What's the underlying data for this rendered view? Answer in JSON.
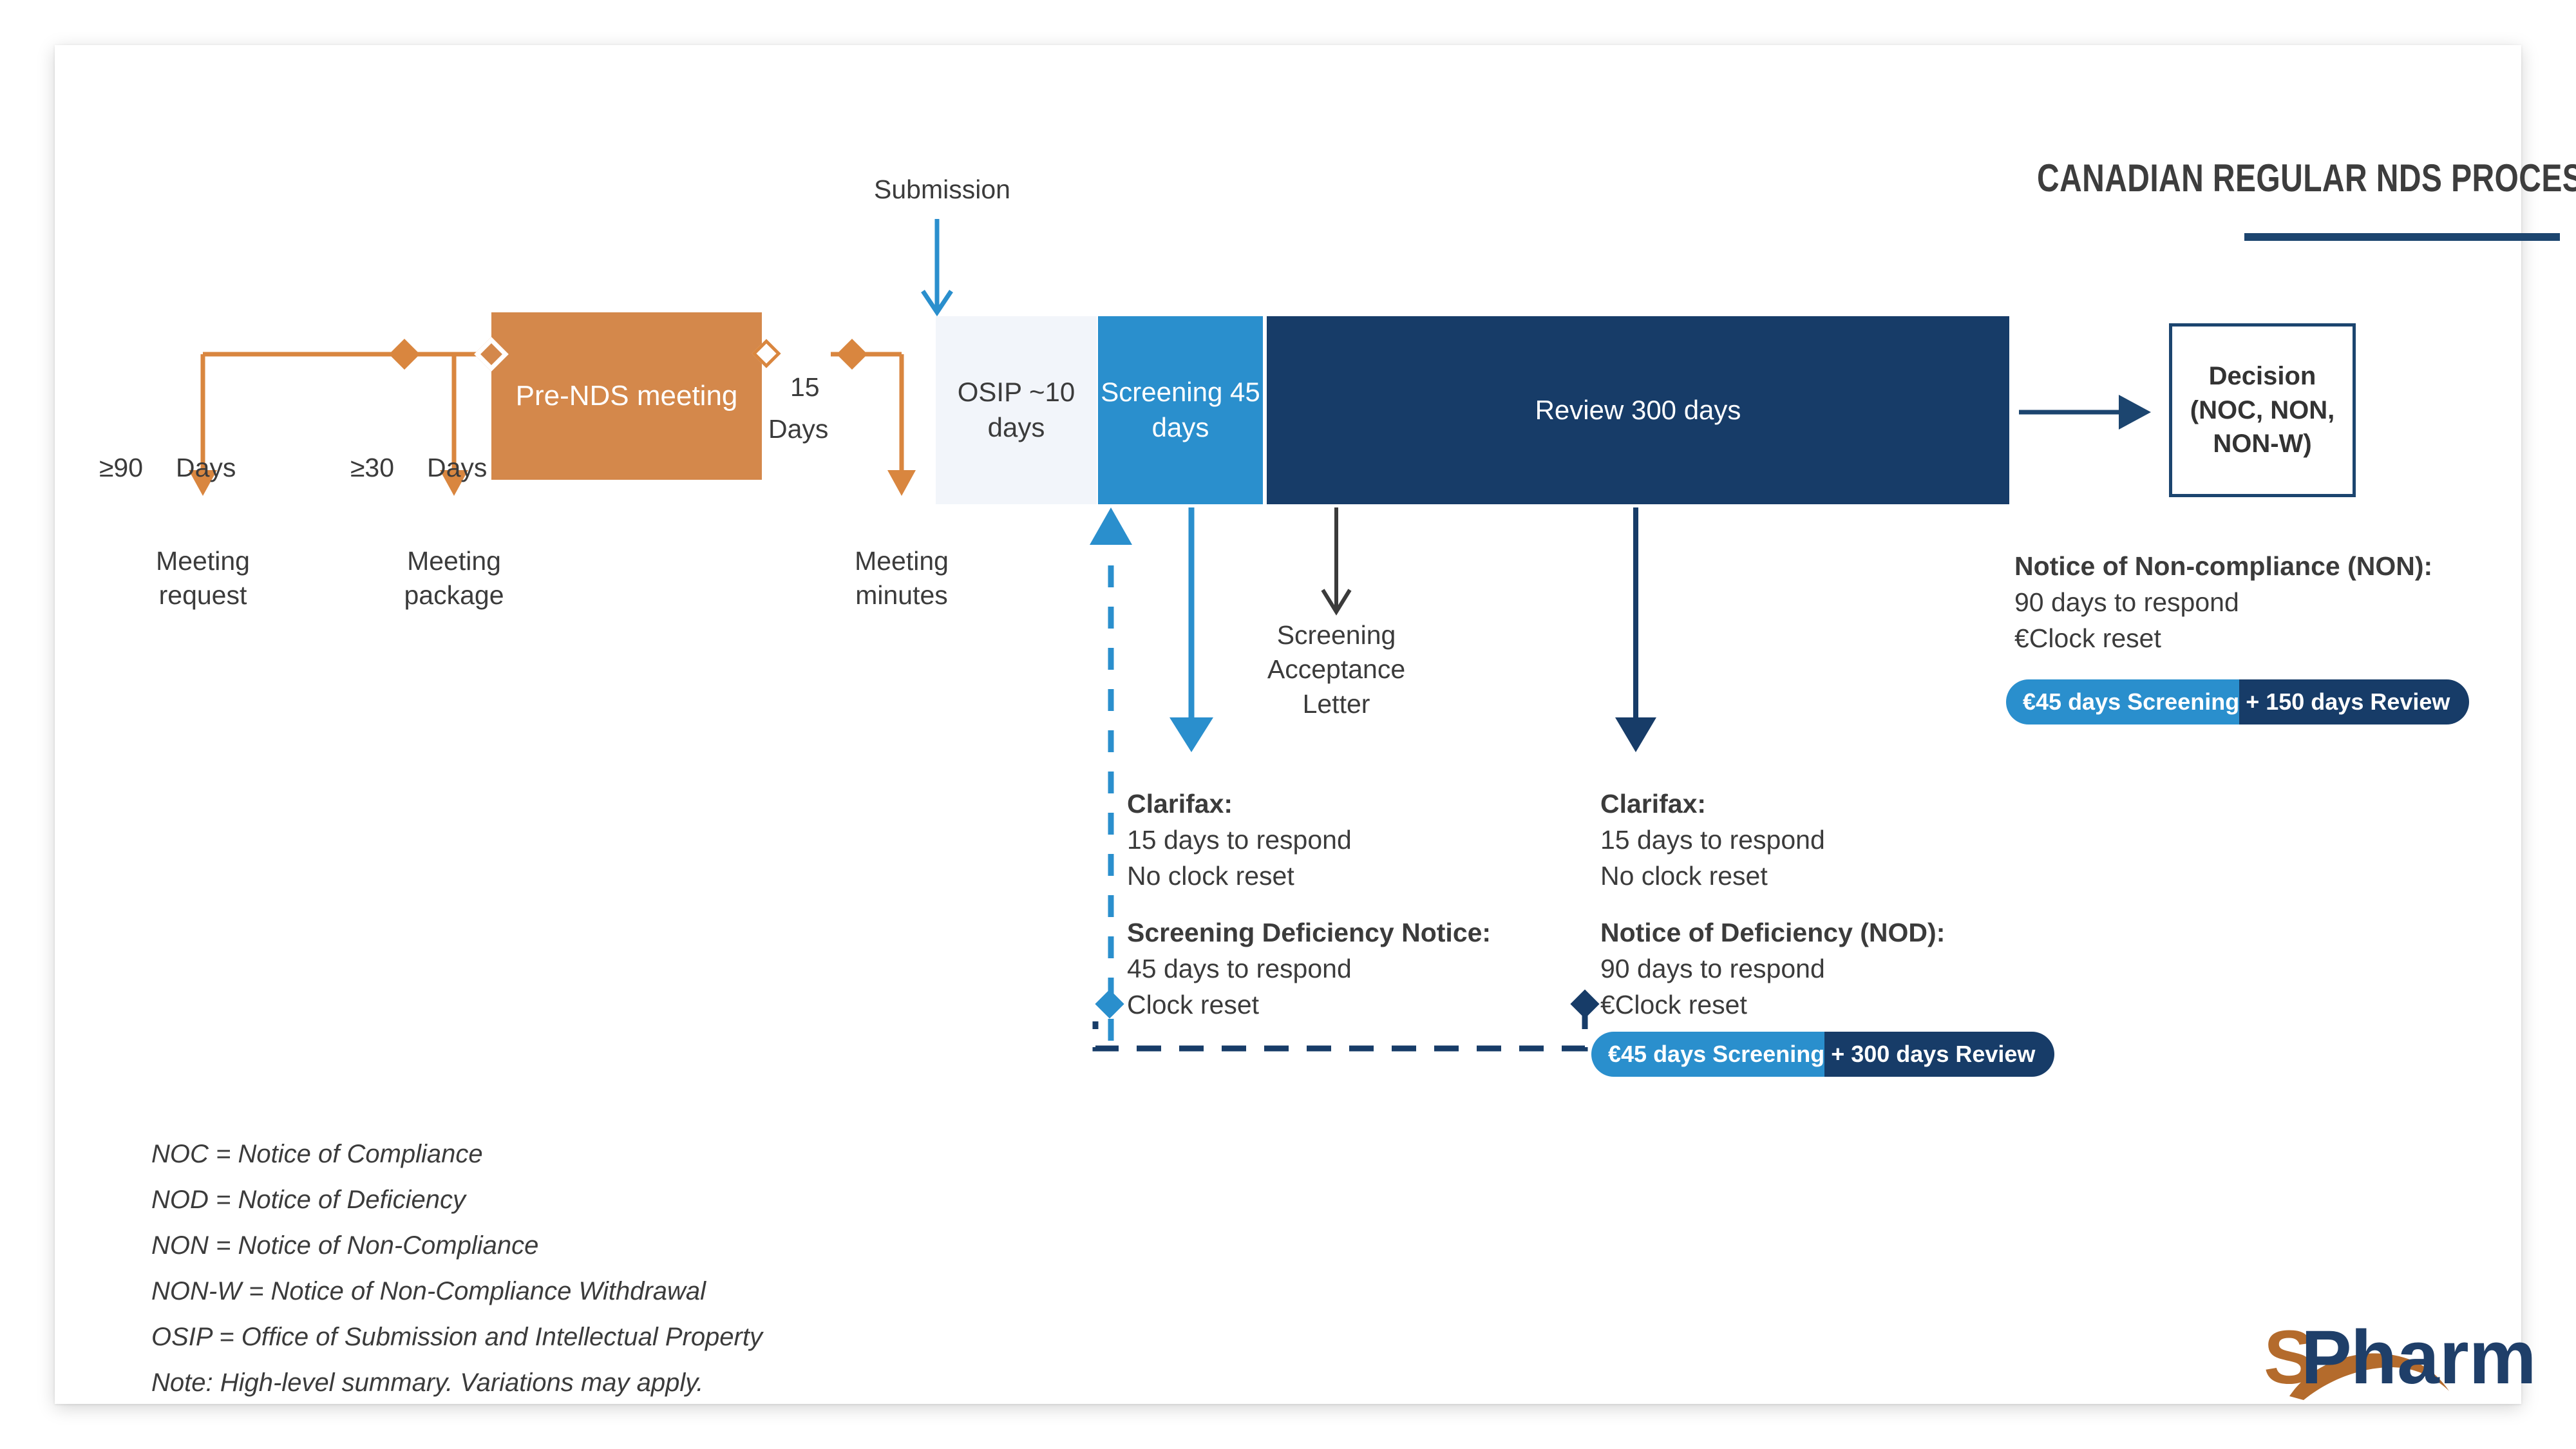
{
  "header": {
    "title": "CANADIAN REGULAR NDS PROCESS"
  },
  "premeeting": {
    "gap1_value": "≥90",
    "gap1_unit": "Days",
    "gap2_value": "≥30",
    "gap2_unit": "Days",
    "gap3_value": "15",
    "gap3_unit": "Days",
    "box_label": "Pre-NDS\nmeeting",
    "milestone1": "Meeting\nrequest",
    "milestone2": "Meeting\npackage",
    "milestone3": "Meeting\nminutes"
  },
  "submission": {
    "label": "Submission"
  },
  "process": {
    "osip": "OSIP\n~10\ndays",
    "screening": "Screening\n45 days",
    "review": "Review 300 days",
    "decision": "Decision\n(NOC, NON,\nNON-W)"
  },
  "acceptance": {
    "label": "Screening\nAcceptance\nLetter"
  },
  "screening_notes": {
    "clarifax_title": "Clarifax:",
    "clarifax_line1": "15 days to respond",
    "clarifax_line2": "No clock reset",
    "deficiency_title": "Screening Deficiency Notice:",
    "deficiency_line1": "45 days to respond",
    "deficiency_line2": "Clock reset"
  },
  "review_notes": {
    "clarifax_title": "Clarifax:",
    "clarifax_line1": "15 days to respond",
    "clarifax_line2": "No clock reset",
    "nod_title": "Notice of Deficiency (NOD):",
    "nod_line1": "90 days to respond",
    "nod_line2": "€Clock reset"
  },
  "non_notes": {
    "title": "Notice of Non-compliance (NON):",
    "line1": "90 days to respond",
    "line2": "€Clock reset"
  },
  "badges": {
    "non": {
      "left": "€45 days Screening",
      "right": "+ 150 days Review"
    },
    "nod": {
      "left": "€45 days Screening",
      "right": "+ 300 days Review"
    }
  },
  "legend": [
    "NOC = Notice of Compliance",
    "NOD = Notice of Deficiency",
    "NON = Notice of Non-Compliance",
    "NON-W = Notice of Non-Compliance Withdrawal",
    "OSIP = Office of Submission and Intellectual Property",
    "Note: High-level summary. Variations may apply."
  ],
  "logo": {
    "text_s": "S",
    "text_p": "P",
    "text_harm": "harm"
  },
  "colors": {
    "orange": "#d9863f",
    "orange_box": "#d4884b",
    "light_blue": "#2a8fcd",
    "navy": "#173c68",
    "osip_bg": "#f2f5fa",
    "text_dark": "#3b3b3b",
    "title_rule": "#1c456f"
  }
}
